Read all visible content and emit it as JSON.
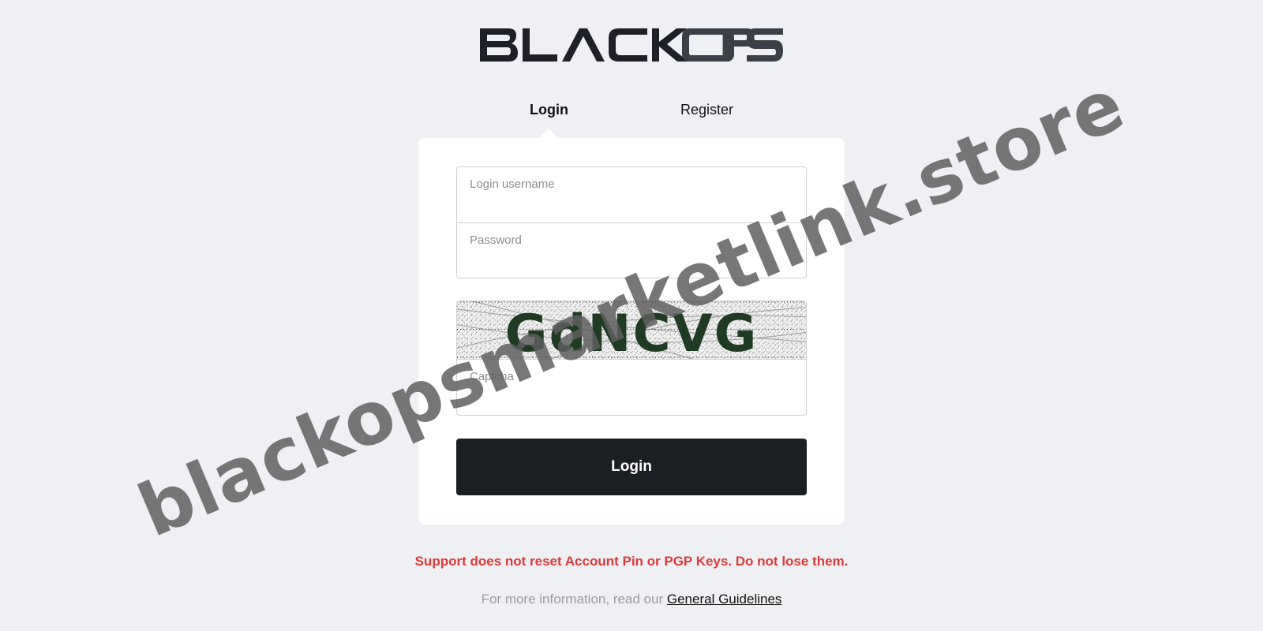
{
  "brand": {
    "logo_text": "BLACK OPS",
    "logo_color_primary": "#1e2027",
    "logo_color_secondary": "#3a3f48"
  },
  "tabs": [
    {
      "label": "Login",
      "active": true
    },
    {
      "label": "Register",
      "active": false
    }
  ],
  "form": {
    "username": {
      "label": "Login username",
      "value": ""
    },
    "password": {
      "label": "Password",
      "value": ""
    },
    "captcha": {
      "image_text": "GdNCVG",
      "label": "Captcha",
      "value": ""
    },
    "submit_label": "Login"
  },
  "notices": {
    "warning": "Support does not reset Account Pin or PGP Keys. Do not lose them.",
    "info_prefix": "For more information, read our",
    "info_link": "General Guidelines"
  },
  "watermark": "blackopsmarketlink.store",
  "colors": {
    "background": "#eff0f4",
    "card": "#ffffff",
    "button": "#1b1f23",
    "warning": "#dc3a3a",
    "muted": "#9a9da1"
  }
}
